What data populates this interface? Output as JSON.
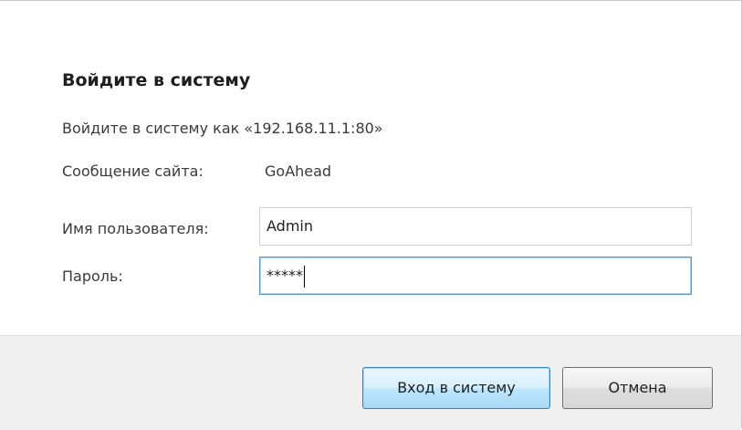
{
  "dialog": {
    "title": "Войдите в систему",
    "login_as": "Войдите в систему как «192.168.11.1:80»",
    "site_message_label": "Сообщение сайта:",
    "site_message_value": "GoAhead",
    "username_label": "Имя пользователя:",
    "username_value": "Admin",
    "password_label": "Пароль:",
    "password_value": "*****"
  },
  "buttons": {
    "login_label": "Вход в систему",
    "cancel_label": "Отмена"
  },
  "colors": {
    "focus_border": "#5b9bd5",
    "footer_background": "#f0f0f0",
    "default_button_border": "#3c7fb1"
  }
}
